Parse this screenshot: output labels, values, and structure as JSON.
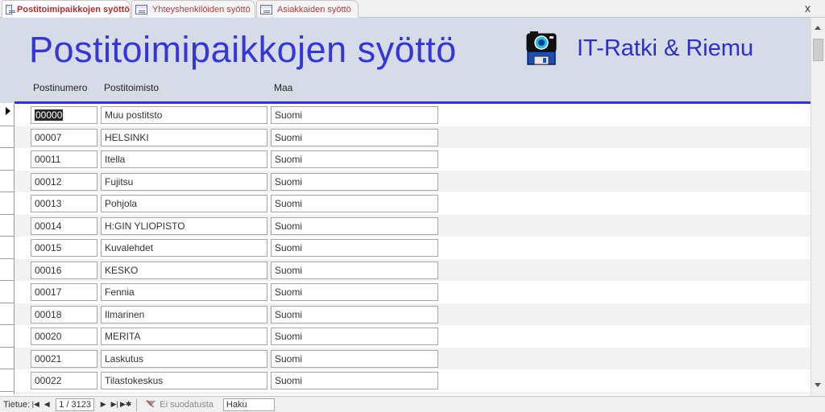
{
  "tabs": [
    {
      "label": "Postitoimipaikkojen syöttö",
      "active": true
    },
    {
      "label": "Yhteyshenkilöiden syöttö",
      "active": false
    },
    {
      "label": "Asiakkaiden syöttö",
      "active": false
    }
  ],
  "close_label": "x",
  "header": {
    "title": "Postitoimipaikkojen syöttö",
    "company": "IT-Ratki & Riemu",
    "logo_icon": "camera-floppy-icon",
    "columns": [
      "Postinumero",
      "Postitoimisto",
      "Maa"
    ]
  },
  "rows": [
    {
      "postinumero": "00000",
      "postitoimisto": "Muu postitsto",
      "maa": "Suomi"
    },
    {
      "postinumero": "00007",
      "postitoimisto": "HELSINKI",
      "maa": "Suomi"
    },
    {
      "postinumero": "00011",
      "postitoimisto": "Itella",
      "maa": "Suomi"
    },
    {
      "postinumero": "00012",
      "postitoimisto": "Fujitsu",
      "maa": "Suomi"
    },
    {
      "postinumero": "00013",
      "postitoimisto": "Pohjola",
      "maa": "Suomi"
    },
    {
      "postinumero": "00014",
      "postitoimisto": "H:GIN YLIOPISTO",
      "maa": "Suomi"
    },
    {
      "postinumero": "00015",
      "postitoimisto": "Kuvalehdet",
      "maa": "Suomi"
    },
    {
      "postinumero": "00016",
      "postitoimisto": "KESKO",
      "maa": "Suomi"
    },
    {
      "postinumero": "00017",
      "postitoimisto": "Fennia",
      "maa": "Suomi"
    },
    {
      "postinumero": "00018",
      "postitoimisto": "Ilmarinen",
      "maa": "Suomi"
    },
    {
      "postinumero": "00020",
      "postitoimisto": "MERITA",
      "maa": "Suomi"
    },
    {
      "postinumero": "00021",
      "postitoimisto": "Laskutus",
      "maa": "Suomi"
    },
    {
      "postinumero": "00022",
      "postitoimisto": "Tilastokeskus",
      "maa": "Suomi"
    },
    {
      "postinumero": "",
      "postitoimisto": "",
      "maa": ""
    }
  ],
  "navigation": {
    "record_label": "Tietue:",
    "record_position": "1 / 3123",
    "first_icon": "first-record-icon",
    "prev_icon": "previous-record-icon",
    "next_icon": "next-record-icon",
    "last_icon": "last-record-icon",
    "new_icon": "new-record-icon",
    "filter_label": "Ei suodatusta",
    "search_value": "Haku"
  },
  "colors": {
    "title": "#3535d8",
    "header_bg": "#d5dbe7",
    "header_rule": "#3030e0",
    "tab_text": "#b03030"
  }
}
